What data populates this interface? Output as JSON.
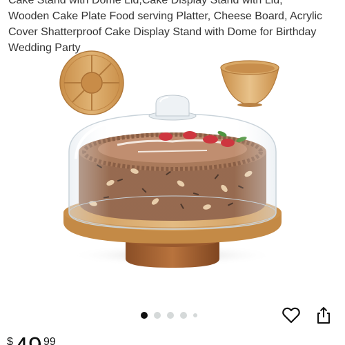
{
  "product": {
    "title_lines": [
      "Cake Stand with Dome Lid,Cake Display Stand with Lid,",
      "Wooden Cake Plate Food serving Platter, Cheese Board, Acrylic",
      "Cover Shatterproof Cake Display Stand with Dome for Birthday",
      "Wedding Party"
    ]
  },
  "gallery": {
    "image_count": 5,
    "active_index": 0
  },
  "actions": {
    "favorite_icon": "heart-outline-icon",
    "share_icon": "share-icon"
  },
  "price": {
    "symbol": "$",
    "whole": "49",
    "fraction": "99"
  },
  "colors": {
    "wood": "#d6a461",
    "cake": "#8b5a3c",
    "active_dot": "#111111",
    "inactive_dot": "#d5d9d9"
  }
}
